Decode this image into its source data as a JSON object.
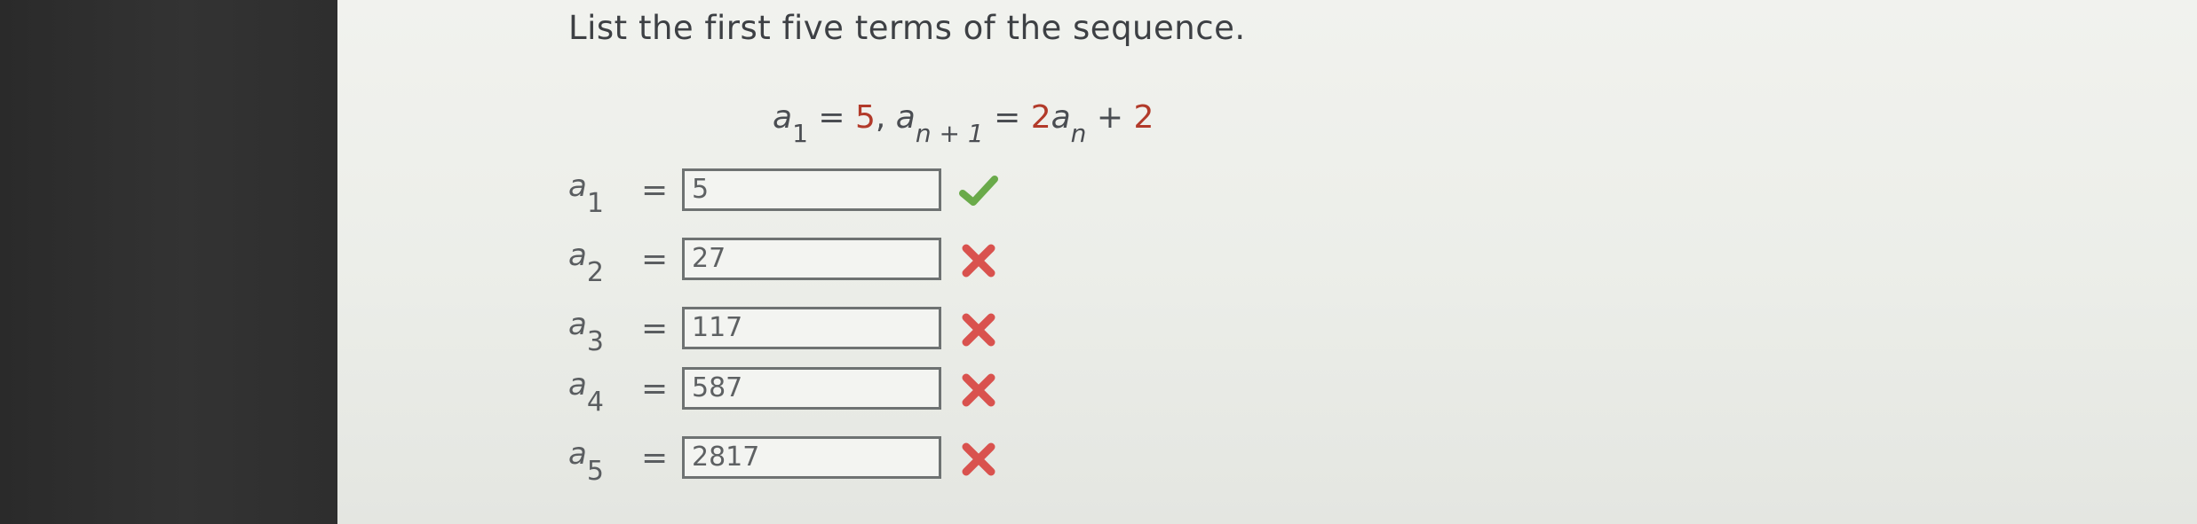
{
  "instruction": "List the first five terms of the sequence.",
  "formula": {
    "a1_symbol": "a",
    "a1_sub": "1",
    "a1_value": " = 5, ",
    "an1_symbol": "a",
    "an1_sub": "n + 1",
    "rhs_eq": " = 2",
    "rhs_symbol": "a",
    "rhs_sub": "n",
    "rhs_tail": " + 2"
  },
  "terms": [
    {
      "symbol": "a",
      "sub": "1",
      "eq": "=",
      "value": "5",
      "status": "check-icon"
    },
    {
      "symbol": "a",
      "sub": "2",
      "eq": "=",
      "value": "27",
      "status": "x-icon"
    },
    {
      "symbol": "a",
      "sub": "3",
      "eq": "=",
      "value": "117",
      "status": "x-icon"
    },
    {
      "symbol": "a",
      "sub": "4",
      "eq": "=",
      "value": "587",
      "status": "x-icon"
    },
    {
      "symbol": "a",
      "sub": "5",
      "eq": "=",
      "value": "2817",
      "status": "x-icon"
    }
  ],
  "colors": {
    "correct": "#6aaa4a",
    "incorrect": "#d9524e",
    "constant": "#b23a2a"
  }
}
